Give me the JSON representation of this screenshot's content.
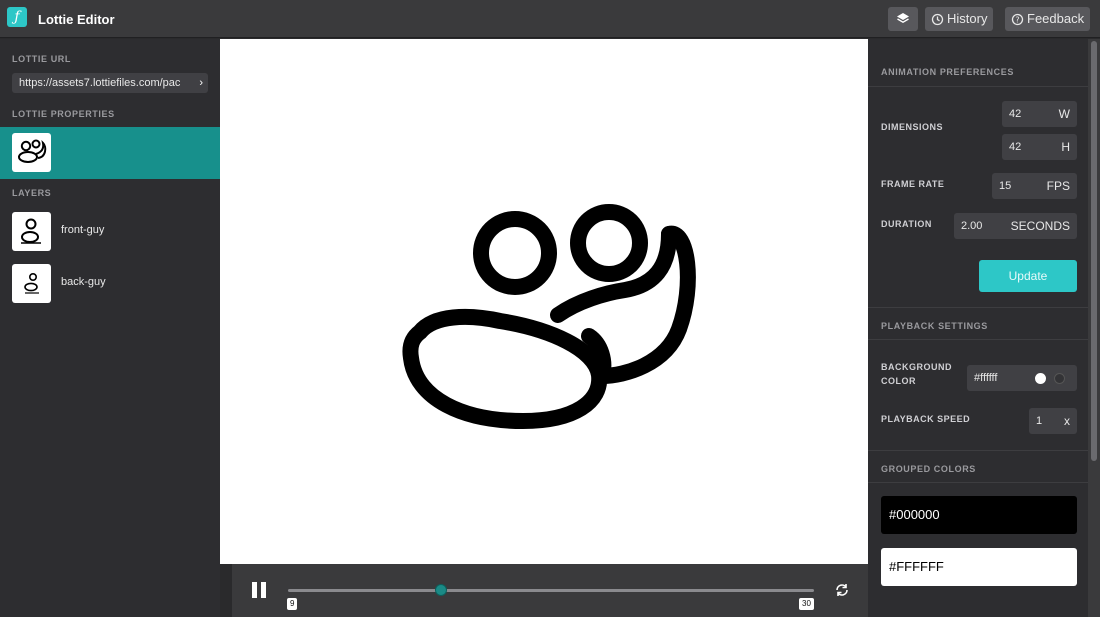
{
  "header": {
    "title": "Lottie Editor",
    "buttons": {
      "layers_label": "",
      "history_label": "History",
      "feedback_label": "Feedback"
    }
  },
  "left": {
    "url_label": "LOTTIE URL",
    "url_value": "https://assets7.lottiefiles.com/pac",
    "properties_label": "LOTTIE PROPERTIES",
    "layers_label": "LAYERS",
    "layers": [
      {
        "name": "front-guy"
      },
      {
        "name": "back-guy"
      }
    ]
  },
  "player": {
    "frame_start": "9",
    "frame_end": "30",
    "progress": 0.29
  },
  "right": {
    "animation_prefs_label": "ANIMATION PREFERENCES",
    "dimensions_label": "DIMENSIONS",
    "width_value": "42",
    "width_unit": "W",
    "height_value": "42",
    "height_unit": "H",
    "frame_rate_label": "FRAME RATE",
    "fps_value": "15",
    "fps_unit": "FPS",
    "duration_label": "DURATION",
    "duration_value": "2.00",
    "duration_unit": "SECONDS",
    "update_label": "Update",
    "playback_settings_label": "PLAYBACK SETTINGS",
    "background_color_label_1": "BACKGROUND",
    "background_color_label_2": "COLOR",
    "background_color_value": "#ffffff",
    "playback_speed_label": "PLAYBACK SPEED",
    "playback_speed_value": "1",
    "playback_speed_unit": "x",
    "grouped_colors_label": "GROUPED COLORS",
    "grouped_colors": [
      "#000000",
      "#FFFFFF"
    ]
  },
  "colors": {
    "accent": "#2dc7c7",
    "selected_row": "#17908c",
    "panel": "#2d2d30",
    "topbar": "#3a3a3c"
  },
  "icons": [
    "lottie-logo-icon",
    "layers-icon",
    "history-icon",
    "feedback-icon",
    "chevron-right-icon",
    "pause-icon",
    "loop-icon"
  ]
}
